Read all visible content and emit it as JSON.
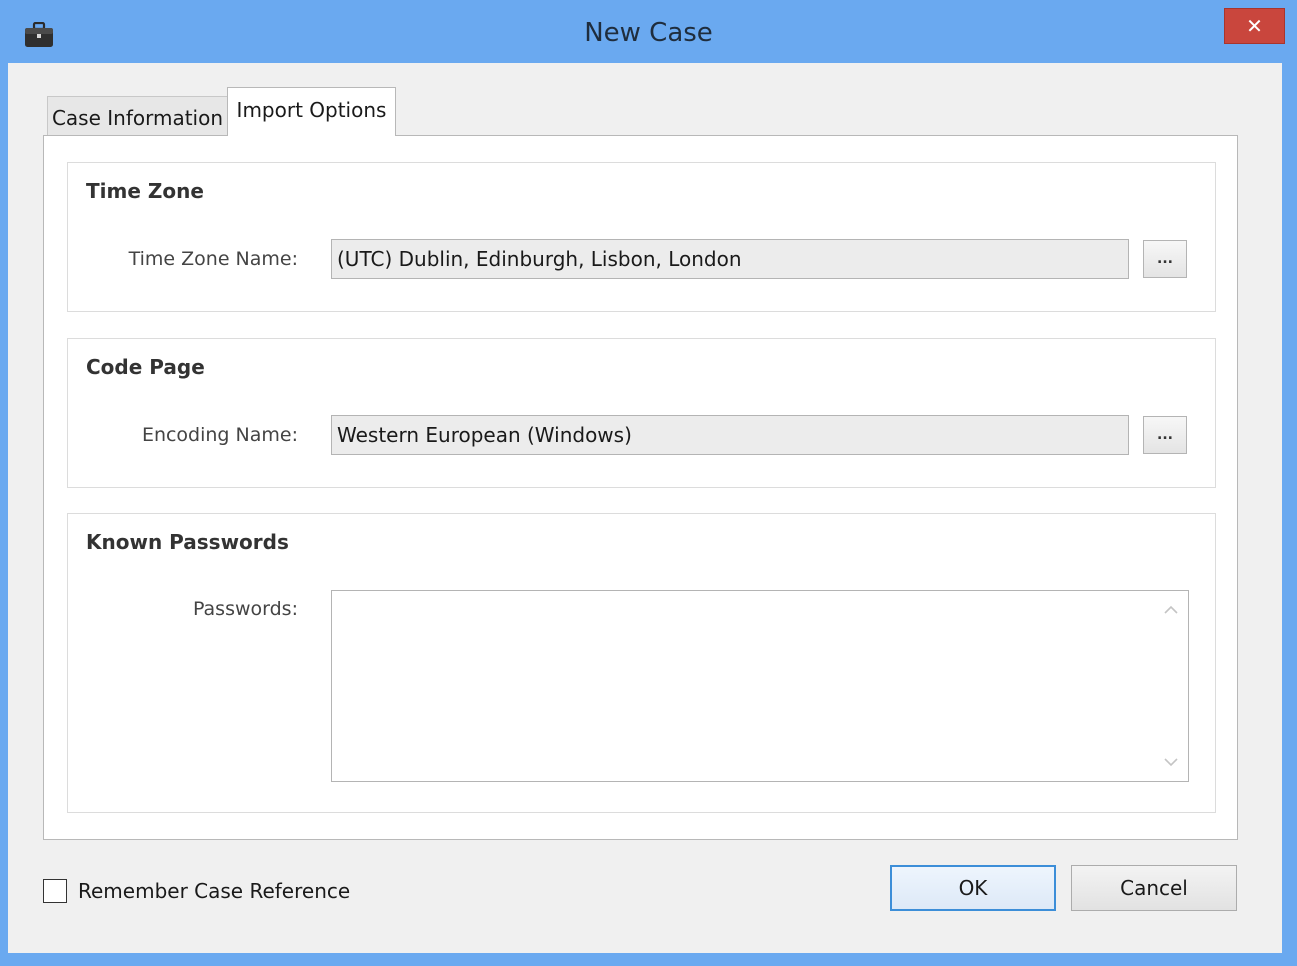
{
  "window": {
    "title": "New Case",
    "close_glyph": "✕",
    "icon": "briefcase-icon"
  },
  "tabs": [
    {
      "label": "Case Information",
      "active": false
    },
    {
      "label": "Import Options",
      "active": true
    }
  ],
  "time_zone": {
    "group_title": "Time Zone",
    "label": "Time Zone Name:",
    "value": "(UTC) Dublin, Edinburgh, Lisbon, London",
    "browse_label": "..."
  },
  "code_page": {
    "group_title": "Code Page",
    "label": "Encoding Name:",
    "value": "Western European (Windows)",
    "browse_label": "..."
  },
  "known_passwords": {
    "group_title": "Known Passwords",
    "label": "Passwords:",
    "value": ""
  },
  "footer": {
    "remember_label": "Remember Case Reference",
    "remember_checked": false,
    "ok_label": "OK",
    "cancel_label": "Cancel"
  },
  "colors": {
    "titlebar": "#6aa9f0",
    "close_button": "#c9463d",
    "client_bg": "#f0f0f0",
    "ok_border": "#3c8ed8"
  }
}
